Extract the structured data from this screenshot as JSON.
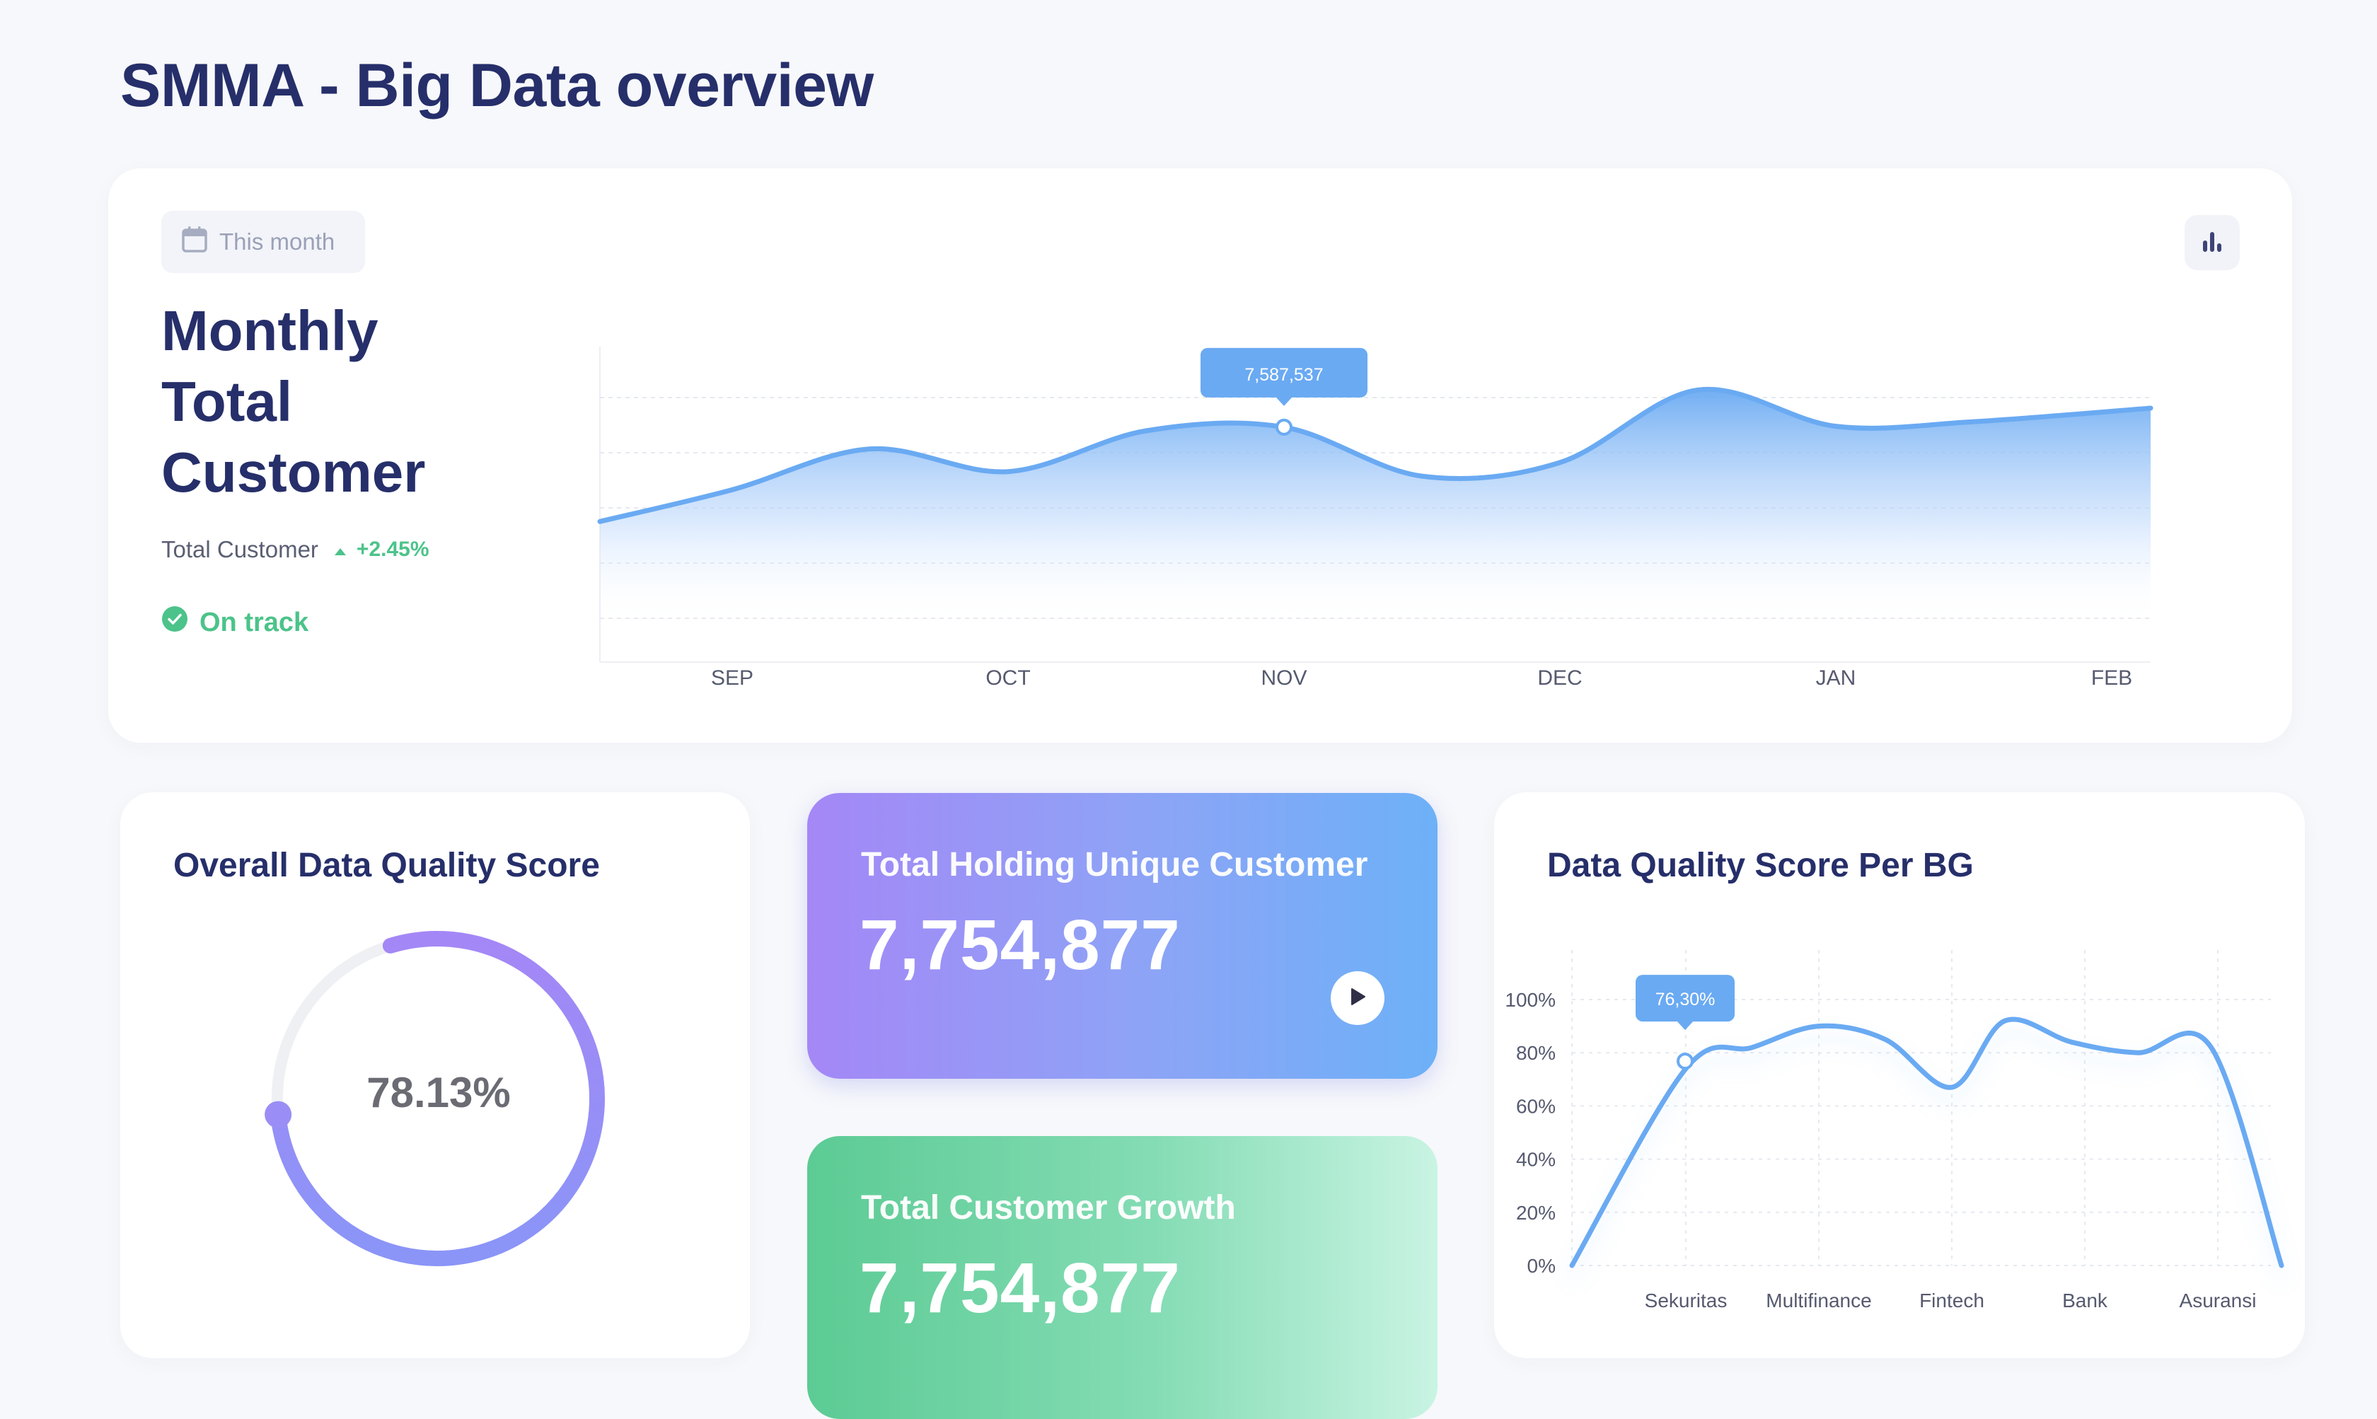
{
  "page": {
    "title": "SMMA - Big Data overview"
  },
  "monthly_card": {
    "period_chip": "This month",
    "title_lines": [
      "Monthly",
      "Total",
      "Customer"
    ],
    "total_label": "Total Customer",
    "change": "+2.45%",
    "status": "On track",
    "tooltip": "7,587,537"
  },
  "quality_card": {
    "title": "Overall Data Quality Score",
    "percent_label": "78.13%",
    "percent": 78.13
  },
  "holding_card": {
    "title": "Total Holding Unique Customer",
    "value": "7,754,877"
  },
  "growth_card": {
    "title": "Total Customer Growth",
    "value": "7,754,877"
  },
  "bg_card": {
    "title": "Data Quality Score Per BG",
    "tooltip": "76,30%"
  },
  "colors": {
    "accent_blue": "#6aaaf2",
    "green": "#4cc38a",
    "purple": "#a487f6",
    "navy": "#262f6a"
  },
  "chart_data": [
    {
      "type": "area",
      "categories": [
        "SEP",
        "OCT",
        "NOV",
        "DEC",
        "JAN",
        "FEB"
      ],
      "x_points": [
        0,
        0.5,
        1,
        1.5,
        2,
        2.5,
        3,
        3.5,
        4,
        4.5,
        5
      ],
      "values": [
        6.9,
        7.35,
        7.1,
        7.55,
        7.59,
        7.05,
        7.2,
        8.0,
        7.6,
        7.65,
        7.8
      ],
      "ylim": [
        5.0,
        8.4
      ],
      "highlight": {
        "category": "NOV",
        "value": 7587537,
        "label": "7,587,537"
      },
      "grid": true
    },
    {
      "type": "line",
      "categories": [
        "Sekuritas",
        "Multifinance",
        "Fintech",
        "Bank",
        "Asuransi"
      ],
      "x_points": [
        -0.7,
        0,
        0.5,
        1,
        1.5,
        2,
        2.4,
        2.9,
        3.4,
        3.95,
        4.4
      ],
      "values": [
        0,
        74,
        82,
        90,
        85,
        67,
        92,
        84,
        80,
        82,
        0
      ],
      "ylim": [
        0,
        100
      ],
      "yticks": [
        "100%",
        "80%",
        "60%",
        "40%",
        "20%",
        "0%"
      ],
      "highlight": {
        "category": "Sekuritas",
        "value": 76.3,
        "label": "76,30%"
      },
      "grid": true
    }
  ]
}
